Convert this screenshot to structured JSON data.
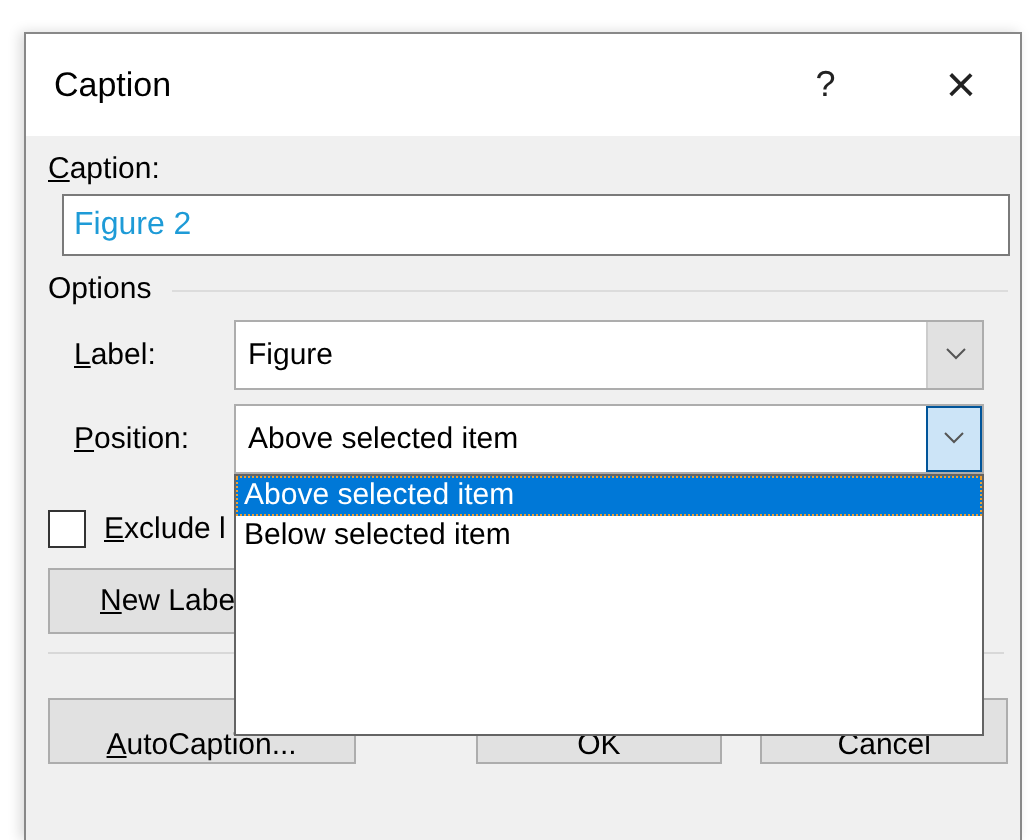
{
  "window": {
    "title": "Caption",
    "help": "?",
    "close": "×"
  },
  "caption": {
    "label": "Caption:",
    "value": "Figure 2"
  },
  "options": {
    "title": "Options",
    "label_field": {
      "label": "Label:",
      "value": "Figure"
    },
    "position_field": {
      "label": "Position:",
      "value": "Above selected item",
      "expanded": true,
      "items": [
        {
          "text": "Above selected item",
          "selected": true
        },
        {
          "text": "Below selected item",
          "selected": false
        }
      ]
    },
    "exclude": {
      "label": "Exclude l",
      "checked": false
    }
  },
  "new_label_button": "New Labe",
  "buttons": [
    {
      "label": "AutoCaption..."
    },
    {
      "label": "OK"
    },
    {
      "label": "Cancel"
    }
  ]
}
